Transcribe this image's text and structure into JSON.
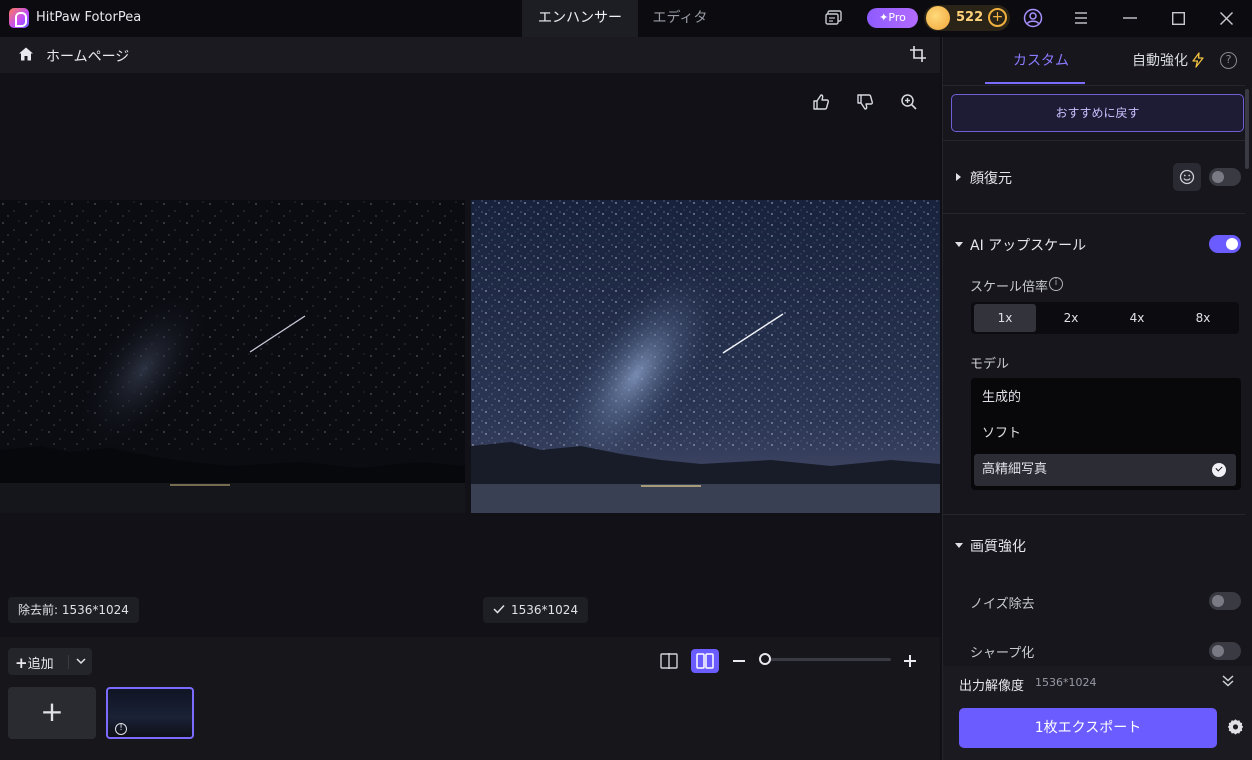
{
  "app": {
    "name": "HitPaw FotorPea"
  },
  "mode_tabs": [
    {
      "label": "エンハンサー",
      "active": true
    },
    {
      "label": "エディタ",
      "active": false
    }
  ],
  "titlebar": {
    "pro_label": "✦Pro",
    "coins": "522"
  },
  "nav": {
    "home_label": "ホームページ"
  },
  "preview": {
    "before_label": "除去前: 1536*1024",
    "after_label": "1536*1024"
  },
  "bottom_bar": {
    "add_label": "追加"
  },
  "panel": {
    "tabs": [
      {
        "label": "カスタム",
        "active": true
      },
      {
        "label": "自動強化",
        "active": false
      }
    ],
    "reset_label": "おすすめに戻す",
    "face_restore": {
      "title": "顔復元",
      "enabled": false
    },
    "ai_upscale": {
      "title": "AI アップスケール",
      "enabled": true,
      "scale_label": "スケール倍率",
      "scale_options": [
        "1x",
        "2x",
        "4x",
        "8x"
      ],
      "scale_selected": "1x",
      "model_label": "モデル",
      "models": [
        "生成的",
        "ソフト",
        "高精細写真"
      ],
      "model_selected": "高精細写真"
    },
    "quality": {
      "title": "画質強化",
      "noise_label": "ノイズ除去",
      "noise_enabled": false,
      "sharpen_label": "シャープ化",
      "sharpen_enabled": false
    },
    "output": {
      "label": "出力解像度",
      "value": "1536*1024"
    },
    "export_label": "1枚エクスポート"
  },
  "colors": {
    "accent": "#6b5cff",
    "accent_text": "#8a7bff",
    "coin": "#ffd27a"
  },
  "icons": [
    "app-logo-icon",
    "feedback-icon",
    "account-icon",
    "menu-icon",
    "minimize-icon",
    "maximize-icon",
    "close-icon",
    "home-icon",
    "crop-icon",
    "thumbs-up-icon",
    "thumbs-down-icon",
    "zoom-in-icon",
    "check-icon",
    "plus-icon",
    "chevron-down-icon",
    "split-view-icon",
    "side-by-side-icon",
    "minus-icon",
    "lightning-icon",
    "help-icon",
    "face-icon",
    "info-icon",
    "double-chevron-icon",
    "settings-icon",
    "warning-icon"
  ]
}
